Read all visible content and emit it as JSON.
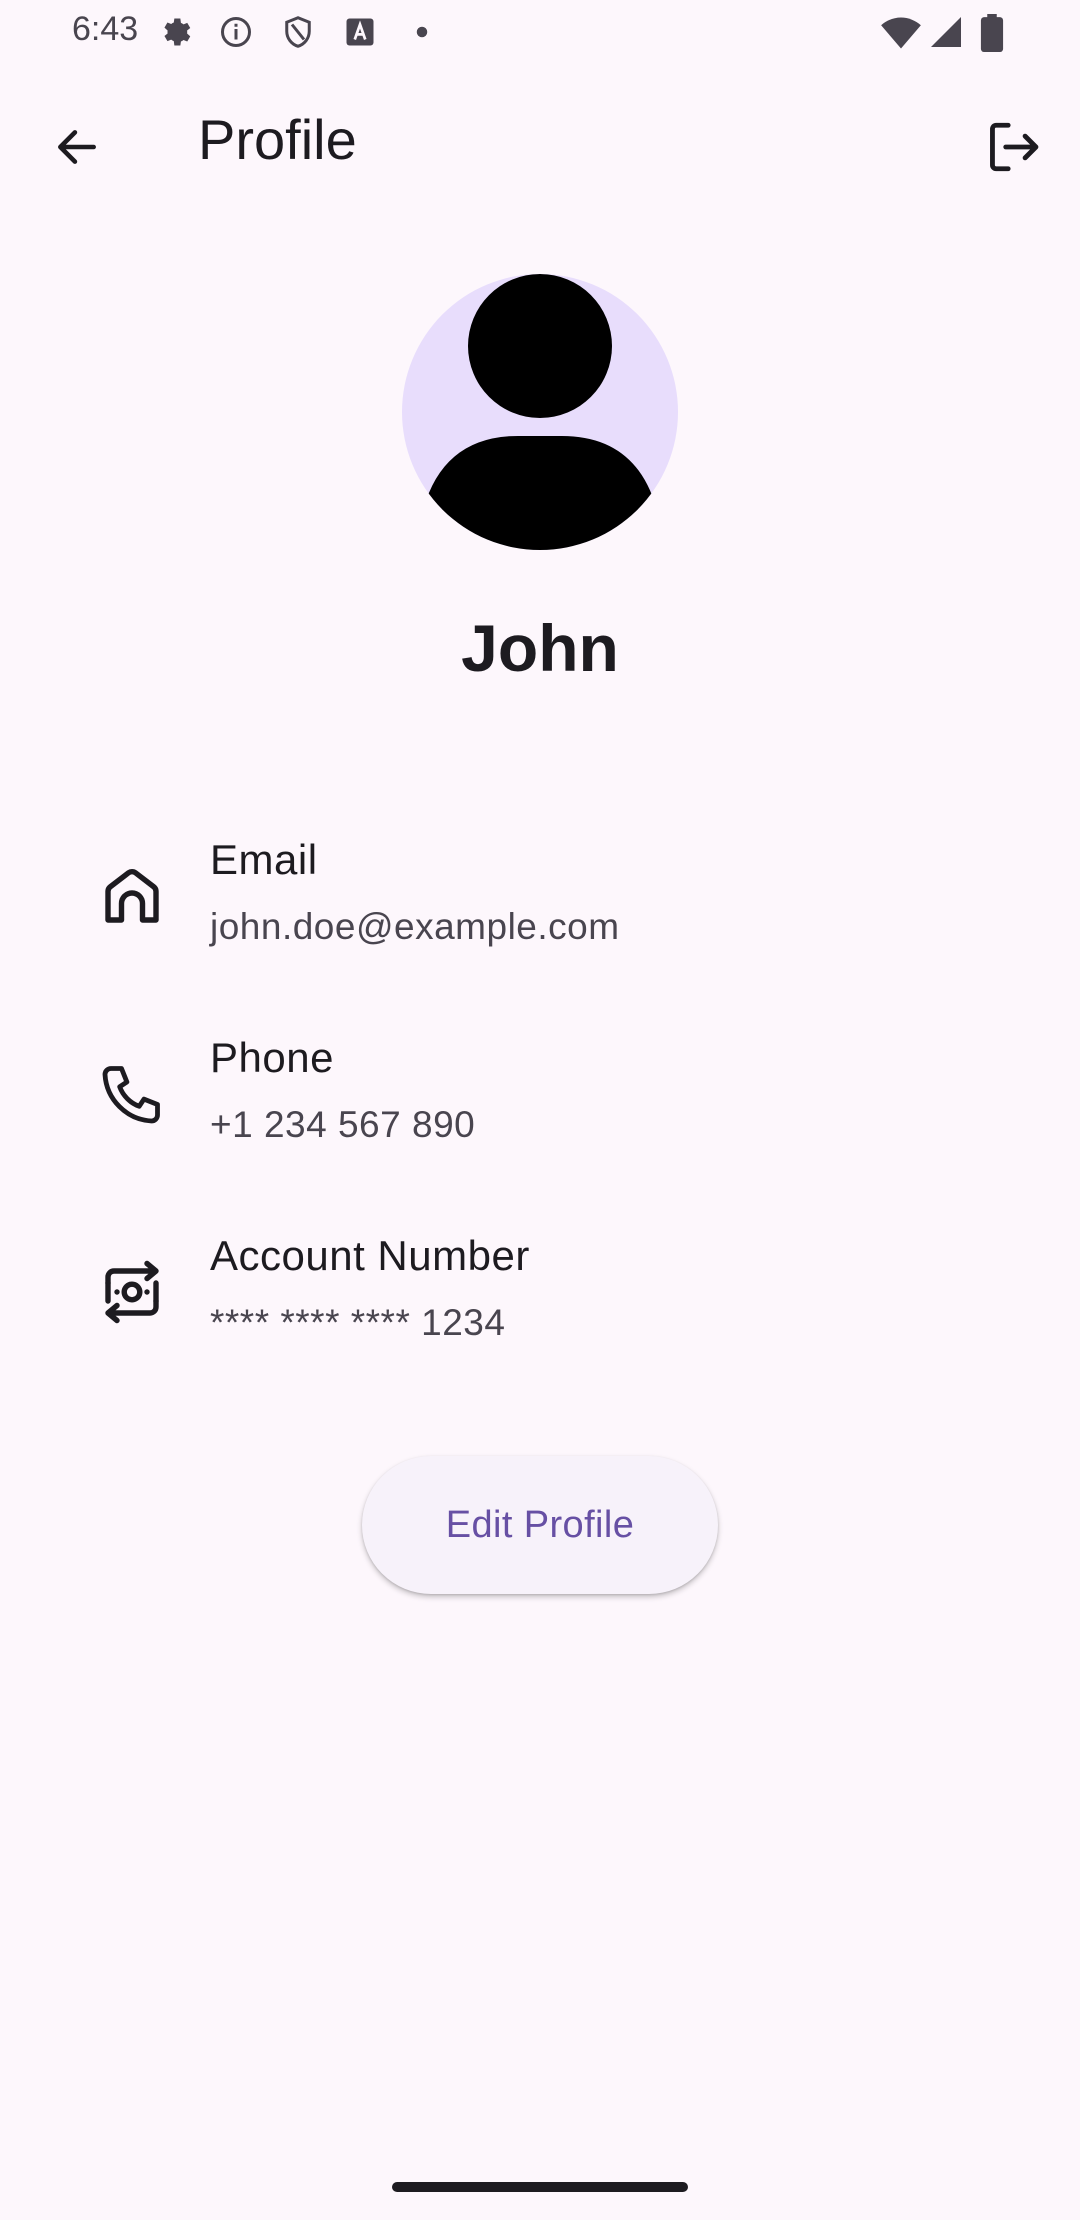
{
  "status_bar": {
    "time": "6:43",
    "icons": [
      "settings-icon",
      "info-icon",
      "shield-icon",
      "font-icon",
      "dot-icon",
      "wifi-icon",
      "signal-icon",
      "battery-icon"
    ]
  },
  "top_bar": {
    "title": "Profile",
    "back_icon": "arrow-back-icon",
    "logout_icon": "logout-icon"
  },
  "profile": {
    "name": "John",
    "avatar_icon": "person-icon"
  },
  "info_items": [
    {
      "icon": "home-icon",
      "label": "Email",
      "value": "john.doe@example.com"
    },
    {
      "icon": "phone-icon",
      "label": "Phone",
      "value": "+1 234 567 890"
    },
    {
      "icon": "money-transfer-icon",
      "label": "Account Number",
      "value": "**** **** **** 1234"
    }
  ],
  "actions": {
    "edit_label": "Edit Profile"
  },
  "colors": {
    "background": "#fdf7fc",
    "avatar_bg": "#e8ddfc",
    "accent": "#6750a4",
    "button_bg": "#f7f2fa"
  }
}
